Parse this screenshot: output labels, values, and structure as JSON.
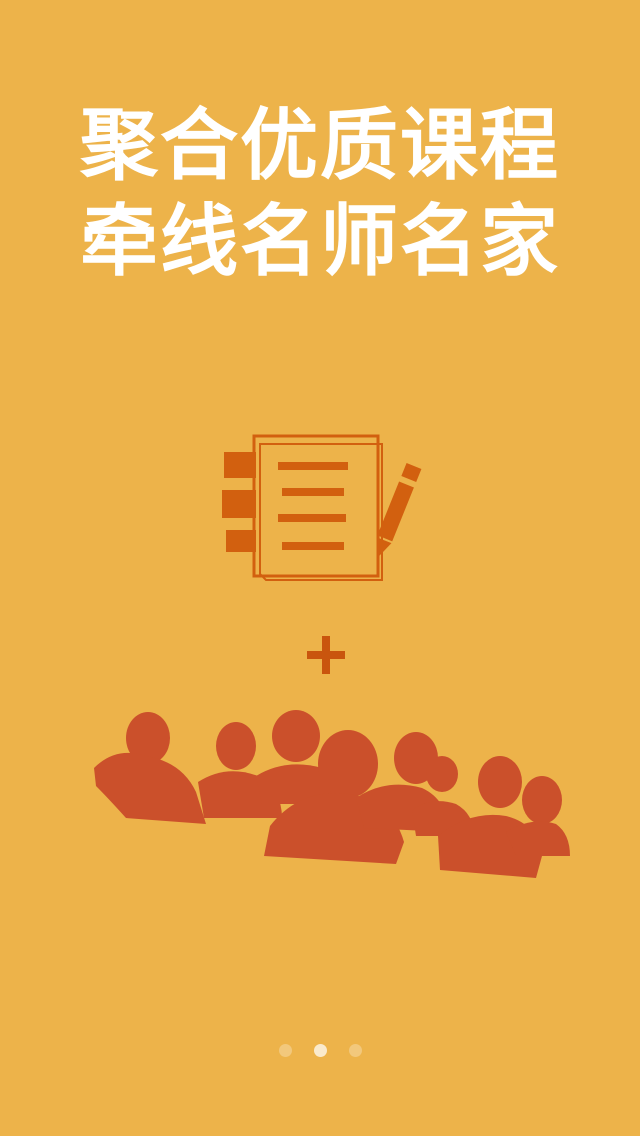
{
  "onboarding": {
    "headline_line1": "聚合优质课程",
    "headline_line2": "牵线名师名家"
  },
  "illustration": {
    "top_icon": "notebook-with-pen-icon",
    "connector_icon": "plus-icon",
    "bottom_icon": "audience-crowd-icon"
  },
  "pager": {
    "pages": 3,
    "active_index": 1
  },
  "colors": {
    "background": "#EDB34A",
    "headline": "#FFFFFF",
    "notebook": "#D2600F",
    "plus": "#C9550E",
    "people": "#CB502B"
  }
}
